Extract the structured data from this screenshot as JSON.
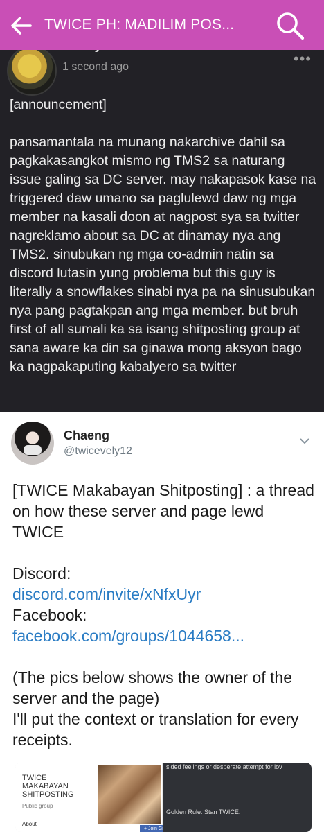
{
  "appbar": {
    "title": "TWICE PH: MADILIM POS...",
    "back_icon": "arrow-left-icon",
    "search_icon": "search-icon",
    "color": "#c94fb6"
  },
  "post": {
    "author": "Ridley Leo",
    "time": "1 second ago",
    "more": "•••",
    "body": "[announcement]\n\npansamantala na munang nakarchive dahil sa pagkakasangkot mismo ng TMS2 sa naturang issue galing sa DC server. may nakapasok kase na triggered daw umano sa paglulewd daw ng mga member na kasali doon at nagpost sya sa twitter nagreklamo about sa DC at dinamay nya ang TMS2. sinubukan ng mga co-admin natin sa discord lutasin yung problema but this guy is literally a snowflakes sinabi nya pa na sinusubukan nya pang pagtakpan ang mga member. but bruh first of all sumali ka sa isang shitposting group at sana aware ka din sa ginawa mong aksyon bago ka nagpakaputing kabalyero sa twitter"
  },
  "tweet": {
    "name": "Chaeng",
    "handle": "@twicevely12",
    "line1": "[TWICE Makabayan Shitposting] : a thread on how these server and page lewd TWICE",
    "discord_label": "Discord:",
    "discord_link": "discord.com/invite/xNfxUyr",
    "facebook_label": "Facebook:",
    "facebook_link": "facebook.com/groups/1044658...",
    "line2": "(The pics below shows the owner of the server and the page)",
    "line3": "I'll put the context or translation for every receipts."
  },
  "attachments": {
    "fb_title": "TWICE MAKABAYAN SHITPOSTING",
    "fb_sub": "Public group",
    "fb_about": "About",
    "fb_join": "+ Join Gr",
    "dark_caption": "sided feelings or desperate attempt for lov",
    "dark_rule": "Golden Rule: Stan TWICE."
  }
}
